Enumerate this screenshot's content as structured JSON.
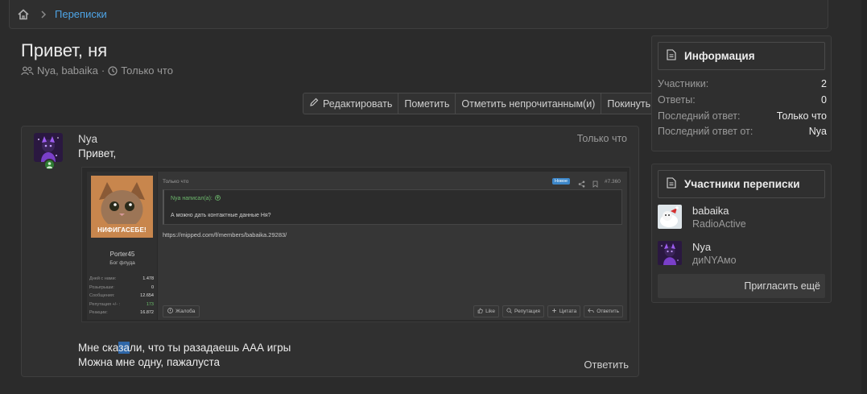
{
  "breadcrumb": {
    "home_icon": "home-icon",
    "item": "Переписки"
  },
  "page": {
    "title": "Привет, ня",
    "meta_participants": "Nya, babaika",
    "meta_sep": "·",
    "meta_time": "Только что"
  },
  "actions": {
    "edit": "Редактировать",
    "mark": "Пометить",
    "mark_unread": "Отметить непрочитанным(и)",
    "leave": "Покинуть"
  },
  "message": {
    "user": "Nya",
    "time": "Только что",
    "line1": "Привет,",
    "line2_before": "Мне ска",
    "line2_selected": "за",
    "line2_after": "ли, что ты разадаешь ААА игры",
    "line3": "Можна мне одну, пажалуста",
    "reply": "Ответить"
  },
  "embed": {
    "avatar_caption": "НИФИГАСЕБЕ!",
    "username": "Porter45",
    "role": "Бог флуда",
    "stats": [
      {
        "k": "Дней с нами:",
        "v": "1.478"
      },
      {
        "k": "Розыгрыши:",
        "v": "0"
      },
      {
        "k": "Сообщения:",
        "v": "12.654"
      },
      {
        "k": "Репутация +/- :",
        "v": "173"
      },
      {
        "k": "Реакции:",
        "v": "16.872"
      }
    ],
    "time": "Только что",
    "badge_new": "Новое",
    "post_num": "#7.360",
    "quote_head": "Nya написал(а):",
    "quote_text": "А можно дать контактные данные Ня?",
    "url": "https://mipped.com/f/members/babaika.29283/",
    "report": "Жалоба",
    "btn_like": "Like",
    "btn_rep": "Репутация",
    "btn_quote": "Цитата",
    "btn_reply": "Ответить"
  },
  "sidebar": {
    "info": {
      "title": "Информация",
      "rows": [
        {
          "k": "Участники:",
          "v": "2"
        },
        {
          "k": "Ответы:",
          "v": "0"
        },
        {
          "k": "Последний ответ:",
          "v": "Только что"
        },
        {
          "k": "Последний ответ от:",
          "v": "Nya"
        }
      ]
    },
    "participants": {
      "title": "Участники переписки",
      "list": [
        {
          "name": "babaika",
          "role": "RadioActive"
        },
        {
          "name": "Nya",
          "role": "диNYAмо"
        }
      ],
      "invite": "Пригласить ещё"
    }
  },
  "colors": {
    "link": "#4ea4e6",
    "background": "#2b2b2b",
    "online": "#2e7d32",
    "selection": "#2f67a8"
  }
}
